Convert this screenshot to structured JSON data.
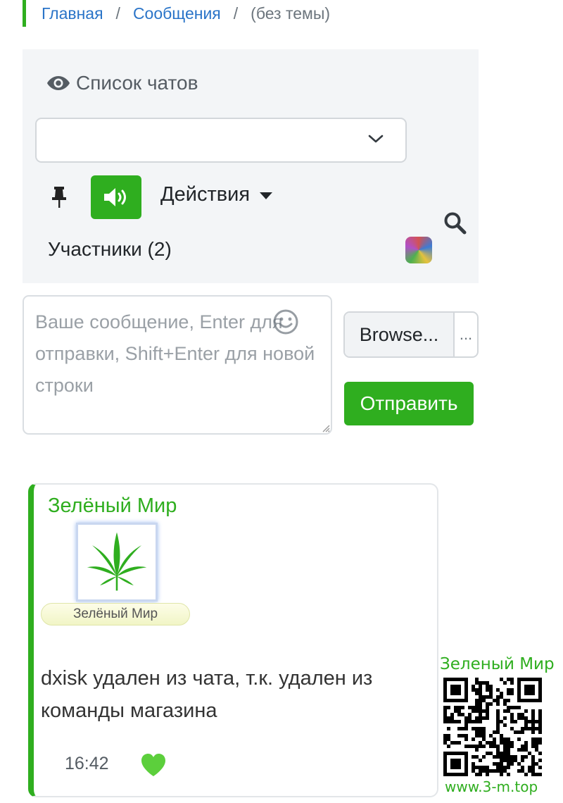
{
  "breadcrumb": {
    "home": "Главная",
    "messages": "Сообщения",
    "current": "(без темы)"
  },
  "chat_panel": {
    "title": "Список чатов",
    "title_icon": "eye-icon",
    "select_value": "",
    "actions_label": "Действия",
    "participants_label": "Участники (2)",
    "accent_color": "#2fae1f"
  },
  "composer": {
    "placeholder": "Ваше сообщение, Enter для отправки, Shift+Enter для новой строки",
    "browse_label": "Browse...",
    "file_placeholder": "...",
    "send_label": "Отправить"
  },
  "message": {
    "author": "Зелёный Мир",
    "badge": "Зелёный Мир",
    "text": "dxisk удален из чата, т.к. удален из команды магазина",
    "time": "16:42"
  },
  "watermark": {
    "title": "Зеленый Мир",
    "url": "www.3-m.top"
  }
}
